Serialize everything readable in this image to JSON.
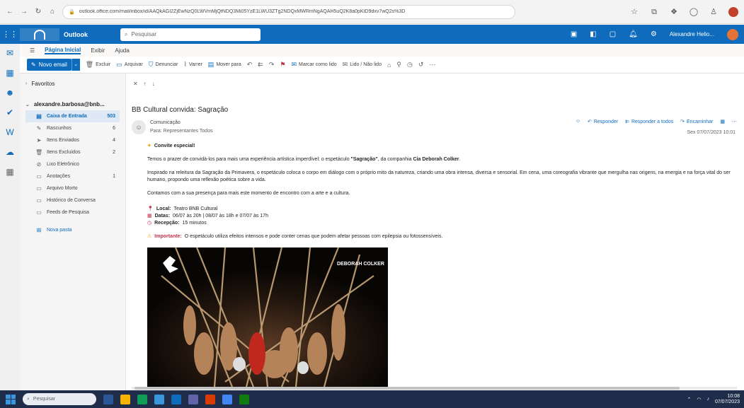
{
  "browser": {
    "url": "outlook.office.com/mail/inbox/id/AAQkAGI2ZjEwNzQ0LWVmMjQtNDQ3Mi05YzE1LWU3ZTg2NDQxMWRmNgAQAH5uQ2K8a0pKtD9dxv7wQ2s%3D"
  },
  "header": {
    "app_name": "Outlook",
    "search_placeholder": "Pesquisar",
    "user_name": "Alexandre Helio..."
  },
  "ribbon": {
    "tabs": [
      "Página Inicial",
      "Exibir",
      "Ajuda"
    ],
    "new_mail": "Novo email",
    "buttons": [
      {
        "label": "Excluir",
        "icon": "trash-icon"
      },
      {
        "label": "Arquivar",
        "icon": "archive-icon"
      },
      {
        "label": "Denunciar",
        "icon": "shield-icon"
      },
      {
        "label": "Varrer",
        "icon": "sweep-icon"
      },
      {
        "label": "Mover para",
        "icon": "folder-move-icon"
      },
      {
        "label": "",
        "icon": "reply-icon"
      },
      {
        "label": "",
        "icon": "reply-all-icon"
      },
      {
        "label": "",
        "icon": "forward-icon"
      },
      {
        "label": "",
        "icon": "flag-icon"
      },
      {
        "label": "Marcar como lido",
        "icon": "read-icon"
      },
      {
        "label": "Lido / Não lido",
        "icon": "envelope-icon"
      },
      {
        "label": "",
        "icon": "tag-icon"
      },
      {
        "label": "",
        "icon": "pin-icon"
      },
      {
        "label": "",
        "icon": "clock-icon"
      },
      {
        "label": "",
        "icon": "undo-icon"
      },
      {
        "label": "",
        "icon": "more-icon"
      }
    ]
  },
  "folders": {
    "favorites_label": "Favoritos",
    "account_label": "alexandre.barbosa@bnb...",
    "items": [
      {
        "label": "Caixa de Entrada",
        "count": "503",
        "icon": "inbox-icon",
        "selected": true
      },
      {
        "label": "Rascunhos",
        "count": "6",
        "icon": "draft-icon",
        "selected": false
      },
      {
        "label": "Itens Enviados",
        "count": "4",
        "icon": "send-icon",
        "selected": false
      },
      {
        "label": "Itens Excluídos",
        "count": "2",
        "icon": "trash-icon",
        "selected": false
      },
      {
        "label": "Lixo Eletrônico",
        "count": "",
        "icon": "junk-icon",
        "selected": false
      },
      {
        "label": "Anotações",
        "count": "1",
        "icon": "note-icon",
        "selected": false
      },
      {
        "label": "Arquivo Morto",
        "count": "",
        "icon": "archive-icon",
        "selected": false
      },
      {
        "label": "Histórico de Conversa",
        "count": "",
        "icon": "history-icon",
        "selected": false
      },
      {
        "label": "Feeds de Pesquisa",
        "count": "",
        "icon": "rss-icon",
        "selected": false
      }
    ],
    "new_folder": "Nova pasta"
  },
  "message": {
    "subject": "BB Cultural convida: Sagração",
    "sender": "Comunicação",
    "to": "Para: Representantes Todos",
    "date": "Sex 07/07/2023 10:01",
    "actions": [
      "Responder",
      "Responder a todos",
      "Encaminhar"
    ],
    "invite": "Convite especial!",
    "p1_start": "Temos o prazer de convidá-los para mais uma experiência artística imperdível: o espetáculo ",
    "p1_bold1": "\"Sagração\"",
    "p1_mid": ", da companhia ",
    "p1_bold2": "Cia Deborah Colker",
    "p1_end": ".",
    "p2": "Inspirado na releitura da Sagração da Primavera, o espetáculo coloca o corpo em diálogo com o próprio mito da natureza, criando uma obra intensa, diversa e sensorial. Em cena, uma coreografia vibrante que mergulha nas origens, na energia e na força vital do ser humano, propondo uma reflexão poética sobre a vida.",
    "p3": "Contamos com a sua presença para mais este momento de encontro com a arte e a cultura.",
    "local_label": "Local:",
    "local_value": "Teatro BNB Cultural",
    "date_label": "Datas:",
    "date_value": "06/07 às 20h | 08/07 às 18h e 07/07 às 17h",
    "rsvp_label": "Recepção:",
    "rsvp_value": "15 minutos",
    "important_label": "Importante:",
    "important_text": "O espetáculo utiliza efeitos intensos e pode conter cenas que podem afetar pessoas com epilepsia ou fotossensíveis.",
    "poster_brand": "DEBORAH COLKER"
  },
  "taskbar": {
    "search_placeholder": "Pesquisar",
    "time": "10:08",
    "date": "07/07/2023"
  }
}
